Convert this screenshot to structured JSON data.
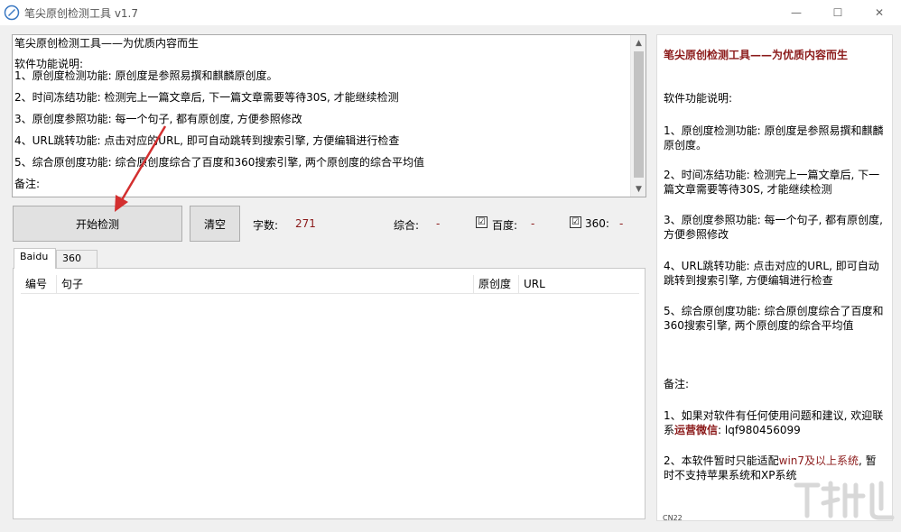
{
  "window": {
    "title": "笔尖原创检测工具 v1.7",
    "minimize": "—",
    "maximize": "☐",
    "close": "✕"
  },
  "description": {
    "lines": [
      "笔尖原创检测工具——为优质内容而生",
      "软件功能说明:",
      "1、原创度检测功能: 原创度是参照易撰和麒麟原创度。",
      "2、时间冻结功能: 检测完上一篇文章后, 下一篇文章需要等待30S, 才能继续检测",
      "3、原创度参照功能: 每一个句子, 都有原创度, 方便参照修改",
      "4、URL跳转功能: 点击对应的URL, 即可自动跳转到搜索引擎, 方便编辑进行检查",
      "5、综合原创度功能: 综合原创度综合了百度和360搜索引擎, 两个原创度的综合平均值",
      "备注:"
    ]
  },
  "toolbar": {
    "start_label": "开始检测",
    "clear_label": "清空",
    "char_count_label": "字数:",
    "char_count_value": "271",
    "overall_label": "综合:",
    "overall_value": "-",
    "baidu_label": "百度:",
    "baidu_value": "-",
    "baidu_checked": "☑",
    "s360_label": "360:",
    "s360_value": "-",
    "s360_checked": "☑"
  },
  "tabs": [
    {
      "label": "Baidu",
      "active": true
    },
    {
      "label": "360",
      "active": false
    }
  ],
  "table": {
    "columns": [
      "编号",
      "句子",
      "原创度",
      "URL"
    ]
  },
  "sidebar": {
    "title": "笔尖原创检测工具——为优质内容而生",
    "heading": "软件功能说明:",
    "items": [
      "1、原创度检测功能: 原创度是参照易撰和麒麟原创度。",
      "2、时间冻结功能: 检测完上一篇文章后, 下一篇文章需要等待30S, 才能继续检测",
      "3、原创度参照功能: 每一个句子, 都有原创度, 方便参照修改",
      "4、URL跳转功能: 点击对应的URL, 即可自动跳转到搜索引擎, 方便编辑进行检查",
      "5、综合原创度功能: 综合原创度综合了百度和360搜索引擎, 两个原创度的综合平均值"
    ],
    "note_heading": "备注:",
    "note1_prefix": "1、如果对软件有任何使用问题和建议, 欢迎联系",
    "note1_highlight": "运营微信",
    "note1_suffix": ": lqf980456099",
    "note2_prefix": "2、本软件暂时只能适配",
    "note2_highlight": "win7及以上系统",
    "note2_suffix": ", 暂时不支持苹果系统和XP系统",
    "ime_label": "CN22"
  },
  "colors": {
    "accent_red": "#8b1a1a",
    "annotation_arrow": "#d32f2f"
  }
}
